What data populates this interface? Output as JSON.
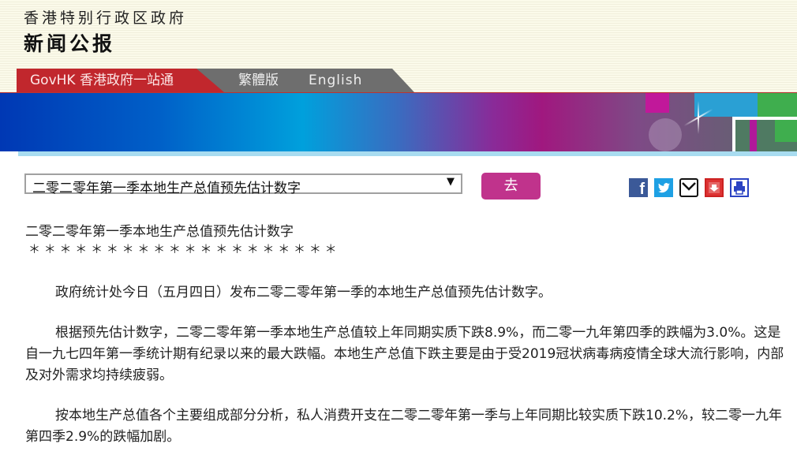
{
  "header": {
    "gov_name": "香港特别行政区政府",
    "press_title": "新闻公报"
  },
  "nav": {
    "govhk_label": "GovHK 香港政府一站通",
    "traditional_label": "繁體版",
    "english_label": "English"
  },
  "toolbar": {
    "select_value": "二零二零年第一季本地生产总值预先估计数字",
    "select_arrow": "▼",
    "go_label": "去",
    "share_icons": [
      "facebook-icon",
      "twitter-icon",
      "email-icon",
      "download-icon",
      "print-icon"
    ],
    "facebook_glyph": "f"
  },
  "article": {
    "title": "二零二零年第一季本地生产总值预先估计数字",
    "stars": "＊ ＊ ＊ ＊ ＊ ＊ ＊ ＊ ＊ ＊ ＊ ＊ ＊ ＊ ＊ ＊ ＊ ＊ ＊ ＊",
    "paragraphs": [
      "政府统计处今日（五月四日）发布二零二零年第一季的本地生产总值预先估计数字。",
      "根据预先估计数字，二零二零年第一季本地生产总值较上年同期实质下跌8.9%，而二零一九年第四季的跌幅为3.0%。这是自一九七四年第一季统计期有纪录以来的最大跌幅。本地生产总值下跌主要是由于受2019冠状病毒病疫情全球大流行影响，内部及对外需求均持续疲弱。",
      "按本地生产总值各个主要组成部分分析，私人消费开支在二零二零年第一季与上年同期比较实质下跌10.2%，较二零一九年第四季2.9%的跌幅加剧。"
    ]
  },
  "colors": {
    "govhk_tab": "#c1272d",
    "lang_tab": "#6e6e6e",
    "go_button": "#c0338c"
  }
}
